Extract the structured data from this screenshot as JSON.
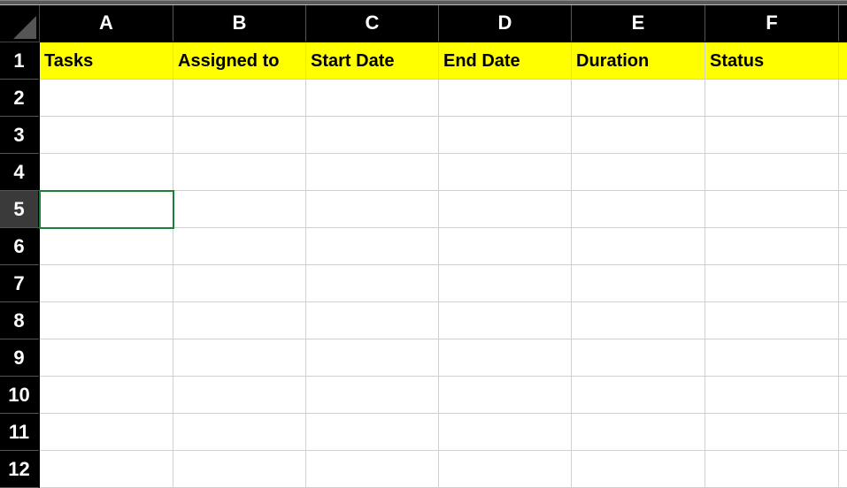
{
  "columns": [
    "A",
    "B",
    "C",
    "D",
    "E",
    "F"
  ],
  "rows": [
    "1",
    "2",
    "3",
    "4",
    "5",
    "6",
    "7",
    "8",
    "9",
    "10",
    "11",
    "12"
  ],
  "activeCell": "A5",
  "headerRow": {
    "A": "Tasks",
    "B": "Assigned to",
    "C": "Start Date",
    "D": "End Date",
    "E": "Duration",
    "F": "Status"
  }
}
